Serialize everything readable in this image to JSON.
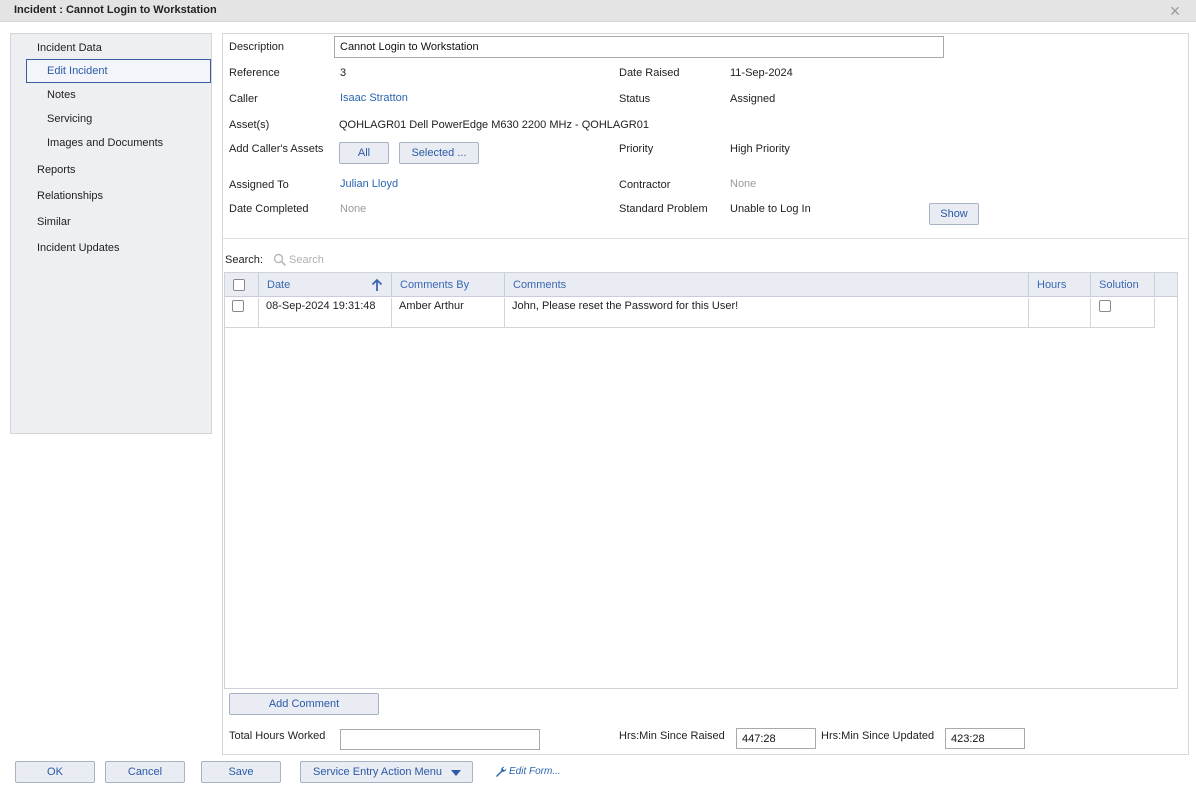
{
  "window": {
    "title": "Incident : Cannot Login to Workstation",
    "close_label": "×"
  },
  "nav": {
    "incident_data": "Incident Data",
    "edit_incident": "Edit Incident",
    "notes": "Notes",
    "servicing": "Servicing",
    "images_docs": "Images and Documents",
    "reports": "Reports",
    "relationships": "Relationships",
    "similar": "Similar",
    "incident_updates": "Incident Updates"
  },
  "form": {
    "description_label": "Description",
    "description_value": "Cannot Login to Workstation",
    "reference_label": "Reference",
    "reference_value": "3",
    "date_raised_label": "Date Raised",
    "date_raised_value": "11-Sep-2024",
    "caller_label": "Caller",
    "caller_value": "Isaac Stratton",
    "status_label": "Status",
    "status_value": "Assigned",
    "assets_label": "Asset(s)",
    "assets_value": "QOHLAGR01 Dell PowerEdge M630 2200 MHz - QOHLAGR01",
    "add_callers_assets_label": "Add Caller's Assets",
    "all_button": "All",
    "selected_button": "Selected ...",
    "priority_label": "Priority",
    "priority_value": "High Priority",
    "assigned_to_label": "Assigned To",
    "assigned_to_value": "Julian Lloyd",
    "contractor_label": "Contractor",
    "contractor_value": "None",
    "date_completed_label": "Date Completed",
    "date_completed_value": "None",
    "standard_problem_label": "Standard Problem",
    "standard_problem_value": "Unable to Log In",
    "show_button": "Show"
  },
  "search": {
    "label": "Search:",
    "placeholder": "Search"
  },
  "grid": {
    "columns": {
      "date": "Date",
      "comments_by": "Comments By",
      "comments": "Comments",
      "hours": "Hours",
      "solution": "Solution"
    },
    "rows": [
      {
        "date": "08-Sep-2024 19:31:48",
        "comments_by": "Amber Arthur",
        "comments": "John, Please reset the Password for this User!",
        "hours": "",
        "solution": false
      }
    ]
  },
  "footer": {
    "add_comment": "Add Comment",
    "total_hours_label": "Total Hours Worked",
    "total_hours_value": "",
    "since_raised_label": "Hrs:Min Since Raised",
    "since_raised_value": "447:28",
    "since_updated_label": "Hrs:Min Since Updated",
    "since_updated_value": "423:28"
  },
  "actions": {
    "ok": "OK",
    "cancel": "Cancel",
    "save": "Save",
    "service_entry_menu": "Service Entry Action Menu",
    "edit_form": "Edit Form..."
  },
  "icons": {
    "close": "close-icon",
    "search": "search-icon",
    "sort": "sort-ascending-icon",
    "dropdown": "caret-down-icon",
    "wrench": "wrench-icon"
  },
  "colors": {
    "link": "#2a65b0",
    "header_text": "#3a67b3",
    "nav_bg": "#eeeff2",
    "button_bg": "#e9ecf2"
  }
}
